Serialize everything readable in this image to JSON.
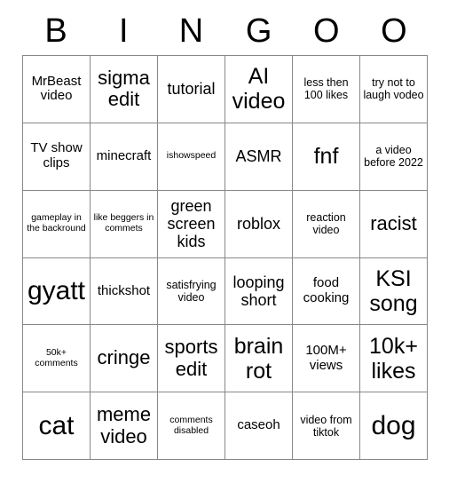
{
  "card": {
    "title_letters": [
      "B",
      "I",
      "N",
      "G",
      "O",
      "O"
    ],
    "columns": 6,
    "rows": 6,
    "grid_line_color": "#888888",
    "background_color": "#ffffff",
    "text_color": "#000000",
    "cells": [
      [
        {
          "label": "MrBeast video",
          "size": "sm"
        },
        {
          "label": "sigma edit",
          "size": "lg"
        },
        {
          "label": "tutorial",
          "size": "md"
        },
        {
          "label": "AI video",
          "size": "xl"
        },
        {
          "label": "less then 100 likes",
          "size": "xs"
        },
        {
          "label": "try not to laugh vodeo",
          "size": "xs"
        }
      ],
      [
        {
          "label": "TV show clips",
          "size": "sm"
        },
        {
          "label": "minecraft",
          "size": "sm"
        },
        {
          "label": "ishowspeed",
          "size": "xxs"
        },
        {
          "label": "ASMR",
          "size": "md"
        },
        {
          "label": "fnf",
          "size": "xl"
        },
        {
          "label": "a video before 2022",
          "size": "xs"
        }
      ],
      [
        {
          "label": "gameplay in the backround",
          "size": "xxs"
        },
        {
          "label": "like beggers in commets",
          "size": "xxs"
        },
        {
          "label": "green screen kids",
          "size": "md"
        },
        {
          "label": "roblox",
          "size": "md"
        },
        {
          "label": "reaction video",
          "size": "xs"
        },
        {
          "label": "racist",
          "size": "lg"
        }
      ],
      [
        {
          "label": "gyatt",
          "size": "xxl"
        },
        {
          "label": "thickshot",
          "size": "sm"
        },
        {
          "label": "satisfrying video",
          "size": "xs"
        },
        {
          "label": "looping short",
          "size": "md"
        },
        {
          "label": "food cooking",
          "size": "sm"
        },
        {
          "label": "KSI song",
          "size": "xl"
        }
      ],
      [
        {
          "label": "50k+ comments",
          "size": "xxs"
        },
        {
          "label": "cringe",
          "size": "lg"
        },
        {
          "label": "sports edit",
          "size": "lg"
        },
        {
          "label": "brain rot",
          "size": "xl"
        },
        {
          "label": "100M+ views",
          "size": "sm"
        },
        {
          "label": "10k+ likes",
          "size": "xl"
        }
      ],
      [
        {
          "label": "cat",
          "size": "xxl"
        },
        {
          "label": "meme video",
          "size": "lg"
        },
        {
          "label": "comments disabled",
          "size": "xxs"
        },
        {
          "label": "caseoh",
          "size": "sm"
        },
        {
          "label": "video from tiktok",
          "size": "xs"
        },
        {
          "label": "dog",
          "size": "xxl"
        }
      ]
    ]
  }
}
